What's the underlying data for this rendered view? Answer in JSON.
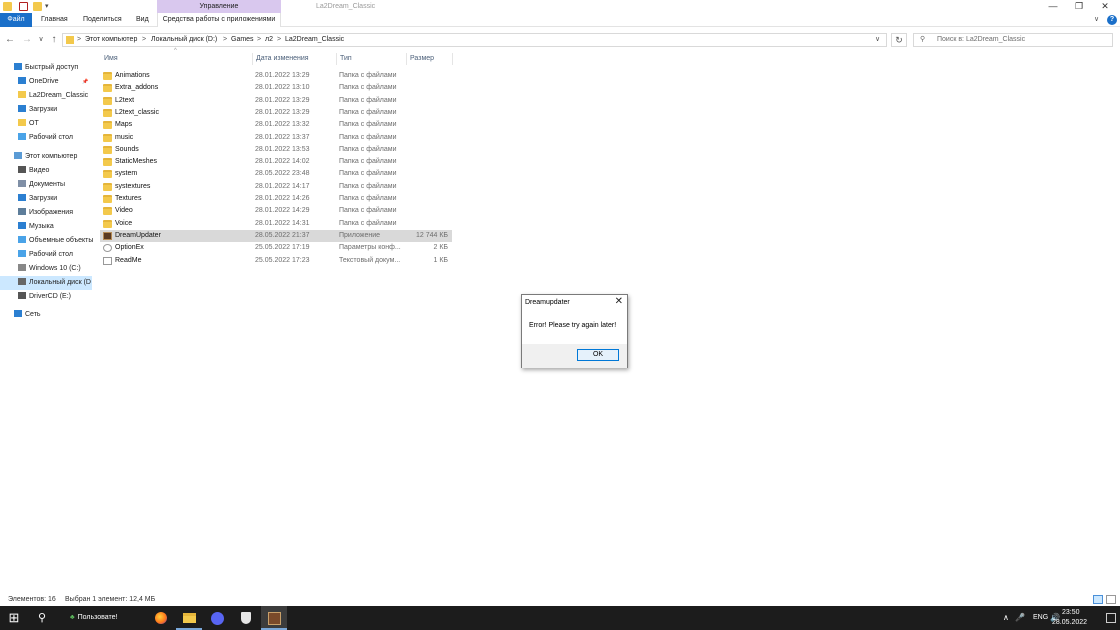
{
  "window": {
    "title": "La2Dream_Classic",
    "manage_tab": "Управление",
    "minimize": "—",
    "maximize": "❐",
    "close": "✕"
  },
  "ribbon": {
    "tabs": [
      "Файл",
      "Главная",
      "Поделиться",
      "Вид"
    ],
    "tools_tab": "Средства работы с приложениями",
    "collapse": "∨",
    "help": "?"
  },
  "nav": {
    "back": "←",
    "forward": "→",
    "recent": "∨",
    "up": "↑",
    "breadcrumb": [
      "Этот компьютер",
      "Локальный диск (D:)",
      "Games",
      "л2",
      "La2Dream_Classic"
    ],
    "separator": ">",
    "dropdown": "∨",
    "refresh": "↻",
    "search_placeholder": "Поиск в: La2Dream_Classic"
  },
  "sidebar": {
    "items": [
      {
        "label": "Быстрый доступ",
        "icon": "star-icon",
        "color": "#2b7fd1",
        "indent": 0
      },
      {
        "label": "OneDrive",
        "icon": "cloud-icon",
        "color": "#2b7fd1",
        "indent": 1,
        "pin": "📌"
      },
      {
        "label": "La2Dream_Classic",
        "icon": "folder-icon",
        "color": "#f3c94c",
        "indent": 1
      },
      {
        "label": "Загрузки",
        "icon": "download-icon",
        "color": "#2b7fd1",
        "indent": 1
      },
      {
        "label": "ОТ",
        "icon": "folder-icon",
        "color": "#f3c94c",
        "indent": 1
      },
      {
        "label": "Рабочий стол",
        "icon": "folder-icon",
        "color": "#4aa3e8",
        "indent": 1
      },
      {
        "label": "Этот компьютер",
        "icon": "computer-icon",
        "color": "#5b9bd5",
        "indent": 0
      },
      {
        "label": "Видео",
        "icon": "video-icon",
        "color": "#555555",
        "indent": 1
      },
      {
        "label": "Документы",
        "icon": "documents-icon",
        "color": "#7f8fa6",
        "indent": 1
      },
      {
        "label": "Загрузки",
        "icon": "download-icon",
        "color": "#2b7fd1",
        "indent": 1
      },
      {
        "label": "Изображения",
        "icon": "pictures-icon",
        "color": "#5d7d9a",
        "indent": 1
      },
      {
        "label": "Музыка",
        "icon": "music-icon",
        "color": "#2b7fd1",
        "indent": 1
      },
      {
        "label": "Объемные объекты",
        "icon": "3d-objects-icon",
        "color": "#4aa3e8",
        "indent": 1
      },
      {
        "label": "Рабочий стол",
        "icon": "folder-icon",
        "color": "#4aa3e8",
        "indent": 1
      },
      {
        "label": "Windows 10 (C:)",
        "icon": "drive-icon",
        "color": "#888888",
        "indent": 1
      },
      {
        "label": "Локальный диск (D",
        "icon": "drive-icon",
        "color": "#666666",
        "indent": 1,
        "selected": true
      },
      {
        "label": "DriverCD (E:)",
        "icon": "cd-drive-icon",
        "color": "#555555",
        "indent": 1
      },
      {
        "label": "Сеть",
        "icon": "network-icon",
        "color": "#2b7fd1",
        "indent": 0
      }
    ]
  },
  "columns": {
    "name": "Имя",
    "date": "Дата изменения",
    "type": "Тип",
    "size": "Размер",
    "sort": "^"
  },
  "files": [
    {
      "name": "Animations",
      "date": "28.01.2022 13:29",
      "type": "Папка с файлами",
      "size": "",
      "icon": "folder-icon"
    },
    {
      "name": "Extra_addons",
      "date": "28.01.2022 13:10",
      "type": "Папка с файлами",
      "size": "",
      "icon": "folder-icon"
    },
    {
      "name": "L2text",
      "date": "28.01.2022 13:29",
      "type": "Папка с файлами",
      "size": "",
      "icon": "folder-icon"
    },
    {
      "name": "L2text_classic",
      "date": "28.01.2022 13:29",
      "type": "Папка с файлами",
      "size": "",
      "icon": "folder-icon"
    },
    {
      "name": "Maps",
      "date": "28.01.2022 13:32",
      "type": "Папка с файлами",
      "size": "",
      "icon": "folder-icon"
    },
    {
      "name": "music",
      "date": "28.01.2022 13:37",
      "type": "Папка с файлами",
      "size": "",
      "icon": "folder-icon"
    },
    {
      "name": "Sounds",
      "date": "28.01.2022 13:53",
      "type": "Папка с файлами",
      "size": "",
      "icon": "folder-icon"
    },
    {
      "name": "StaticMeshes",
      "date": "28.01.2022 14:02",
      "type": "Папка с файлами",
      "size": "",
      "icon": "folder-icon"
    },
    {
      "name": "system",
      "date": "28.05.2022 23:48",
      "type": "Папка с файлами",
      "size": "",
      "icon": "folder-icon"
    },
    {
      "name": "systextures",
      "date": "28.01.2022 14:17",
      "type": "Папка с файлами",
      "size": "",
      "icon": "folder-icon"
    },
    {
      "name": "Textures",
      "date": "28.01.2022 14:26",
      "type": "Папка с файлами",
      "size": "",
      "icon": "folder-icon"
    },
    {
      "name": "Video",
      "date": "28.01.2022 14:29",
      "type": "Папка с файлами",
      "size": "",
      "icon": "folder-icon"
    },
    {
      "name": "Voice",
      "date": "28.01.2022 14:31",
      "type": "Папка с файлами",
      "size": "",
      "icon": "folder-icon"
    },
    {
      "name": "DreamUpdater",
      "date": "28.05.2022 21:37",
      "type": "Приложение",
      "size": "12 744 КБ",
      "icon": "application-icon",
      "selected": true
    },
    {
      "name": "OptionEx",
      "date": "25.05.2022 17:19",
      "type": "Параметры конф...",
      "size": "2 КБ",
      "icon": "settings-file-icon"
    },
    {
      "name": "ReadMe",
      "date": "25.05.2022 17:23",
      "type": "Текстовый докум...",
      "size": "1 КБ",
      "icon": "text-file-icon"
    }
  ],
  "dialog": {
    "title": "Dreamupdater",
    "message": "Error! Please try again later!",
    "ok": "OK",
    "close": "✕"
  },
  "status": {
    "count": "Элементов: 16",
    "selection": "Выбран 1 элемент: 12,4 МБ"
  },
  "taskbar": {
    "start": "⊞",
    "search": "⚲",
    "user_label": "Пользовате!",
    "lang": "ENG",
    "time": "23:50",
    "date": "28.05.2022",
    "tray_up": "∧",
    "mic": "🎤",
    "volume": "🔊"
  }
}
